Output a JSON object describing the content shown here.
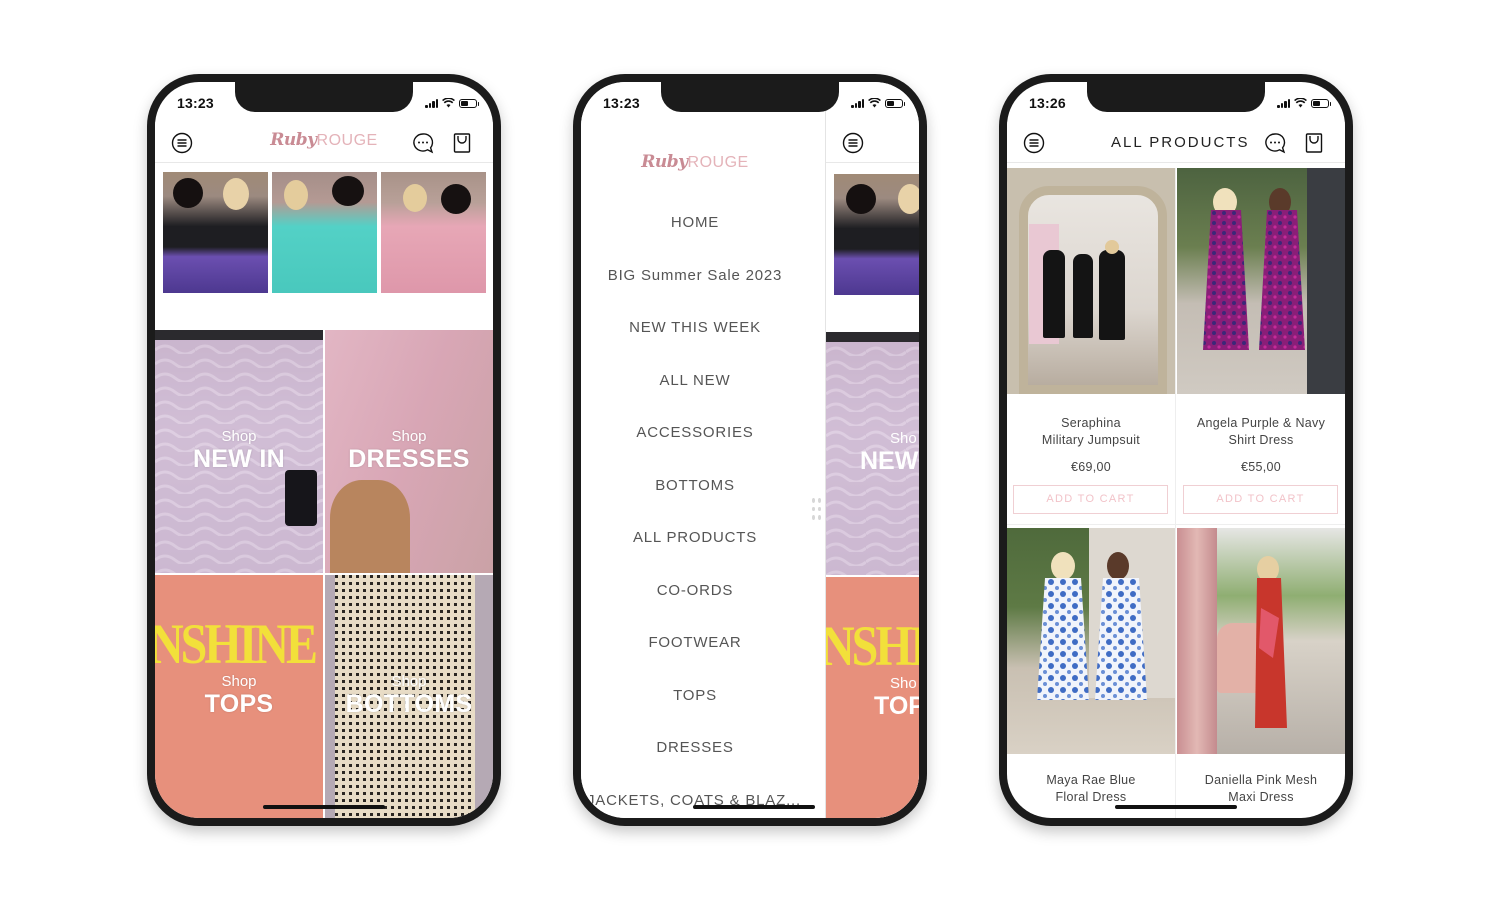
{
  "brand": {
    "script": "Ruby",
    "word": "ROUGE",
    "colors": {
      "script": "#c98b94",
      "word": "#e4b3b9",
      "accent_border": "#f0cfd3"
    }
  },
  "phones": [
    {
      "status": {
        "time": "13:23"
      },
      "header": {
        "left_icon": "menu-icon",
        "right_icons": [
          "chat-icon",
          "shopping-bag-icon"
        ]
      },
      "gallery": [
        {
          "alt": "Two models in black tops and purple print skirts"
        },
        {
          "alt": "Two models in turquoise dresses holding flowers"
        },
        {
          "alt": "Two models in pink floral dresses"
        }
      ],
      "tiles": [
        {
          "prefix": "Shop",
          "title": "NEW IN"
        },
        {
          "prefix": "Shop",
          "title": "DRESSES"
        },
        {
          "prefix": "Shop",
          "title": "TOPS",
          "graphic_text": "NSHINE"
        },
        {
          "prefix": "Shop",
          "title": "BOTTOMS"
        }
      ]
    },
    {
      "status": {
        "time": "13:23"
      },
      "menu": {
        "items": [
          "HOME",
          "BIG Summer Sale 2023",
          "NEW THIS WEEK",
          "ALL NEW",
          "ACCESSORIES",
          "BOTTOMS",
          "ALL PRODUCTS",
          "CO-ORDS",
          "FOOTWEAR",
          "TOPS",
          "DRESSES",
          "JACKETS, COATS & BLAZ..."
        ]
      },
      "behind": {
        "tile_prefix": "Sho",
        "tile_new": "NEW",
        "tile_tops": "TOP",
        "graphic_text": "NSHI"
      }
    },
    {
      "status": {
        "time": "13:26"
      },
      "header": {
        "title": "ALL PRODUCTS"
      },
      "products": [
        {
          "name_line1": "Seraphina",
          "name_line2": "Military Jumpsuit",
          "price": "€69,00",
          "button": "ADD TO CART"
        },
        {
          "name_line1": "Angela Purple & Navy",
          "name_line2": "Shirt Dress",
          "price": "€55,00",
          "button": "ADD TO CART"
        },
        {
          "name_line1": "Maya Rae Blue",
          "name_line2": "Floral Dress"
        },
        {
          "name_line1": "Daniella Pink Mesh",
          "name_line2": "Maxi Dress"
        }
      ]
    }
  ]
}
